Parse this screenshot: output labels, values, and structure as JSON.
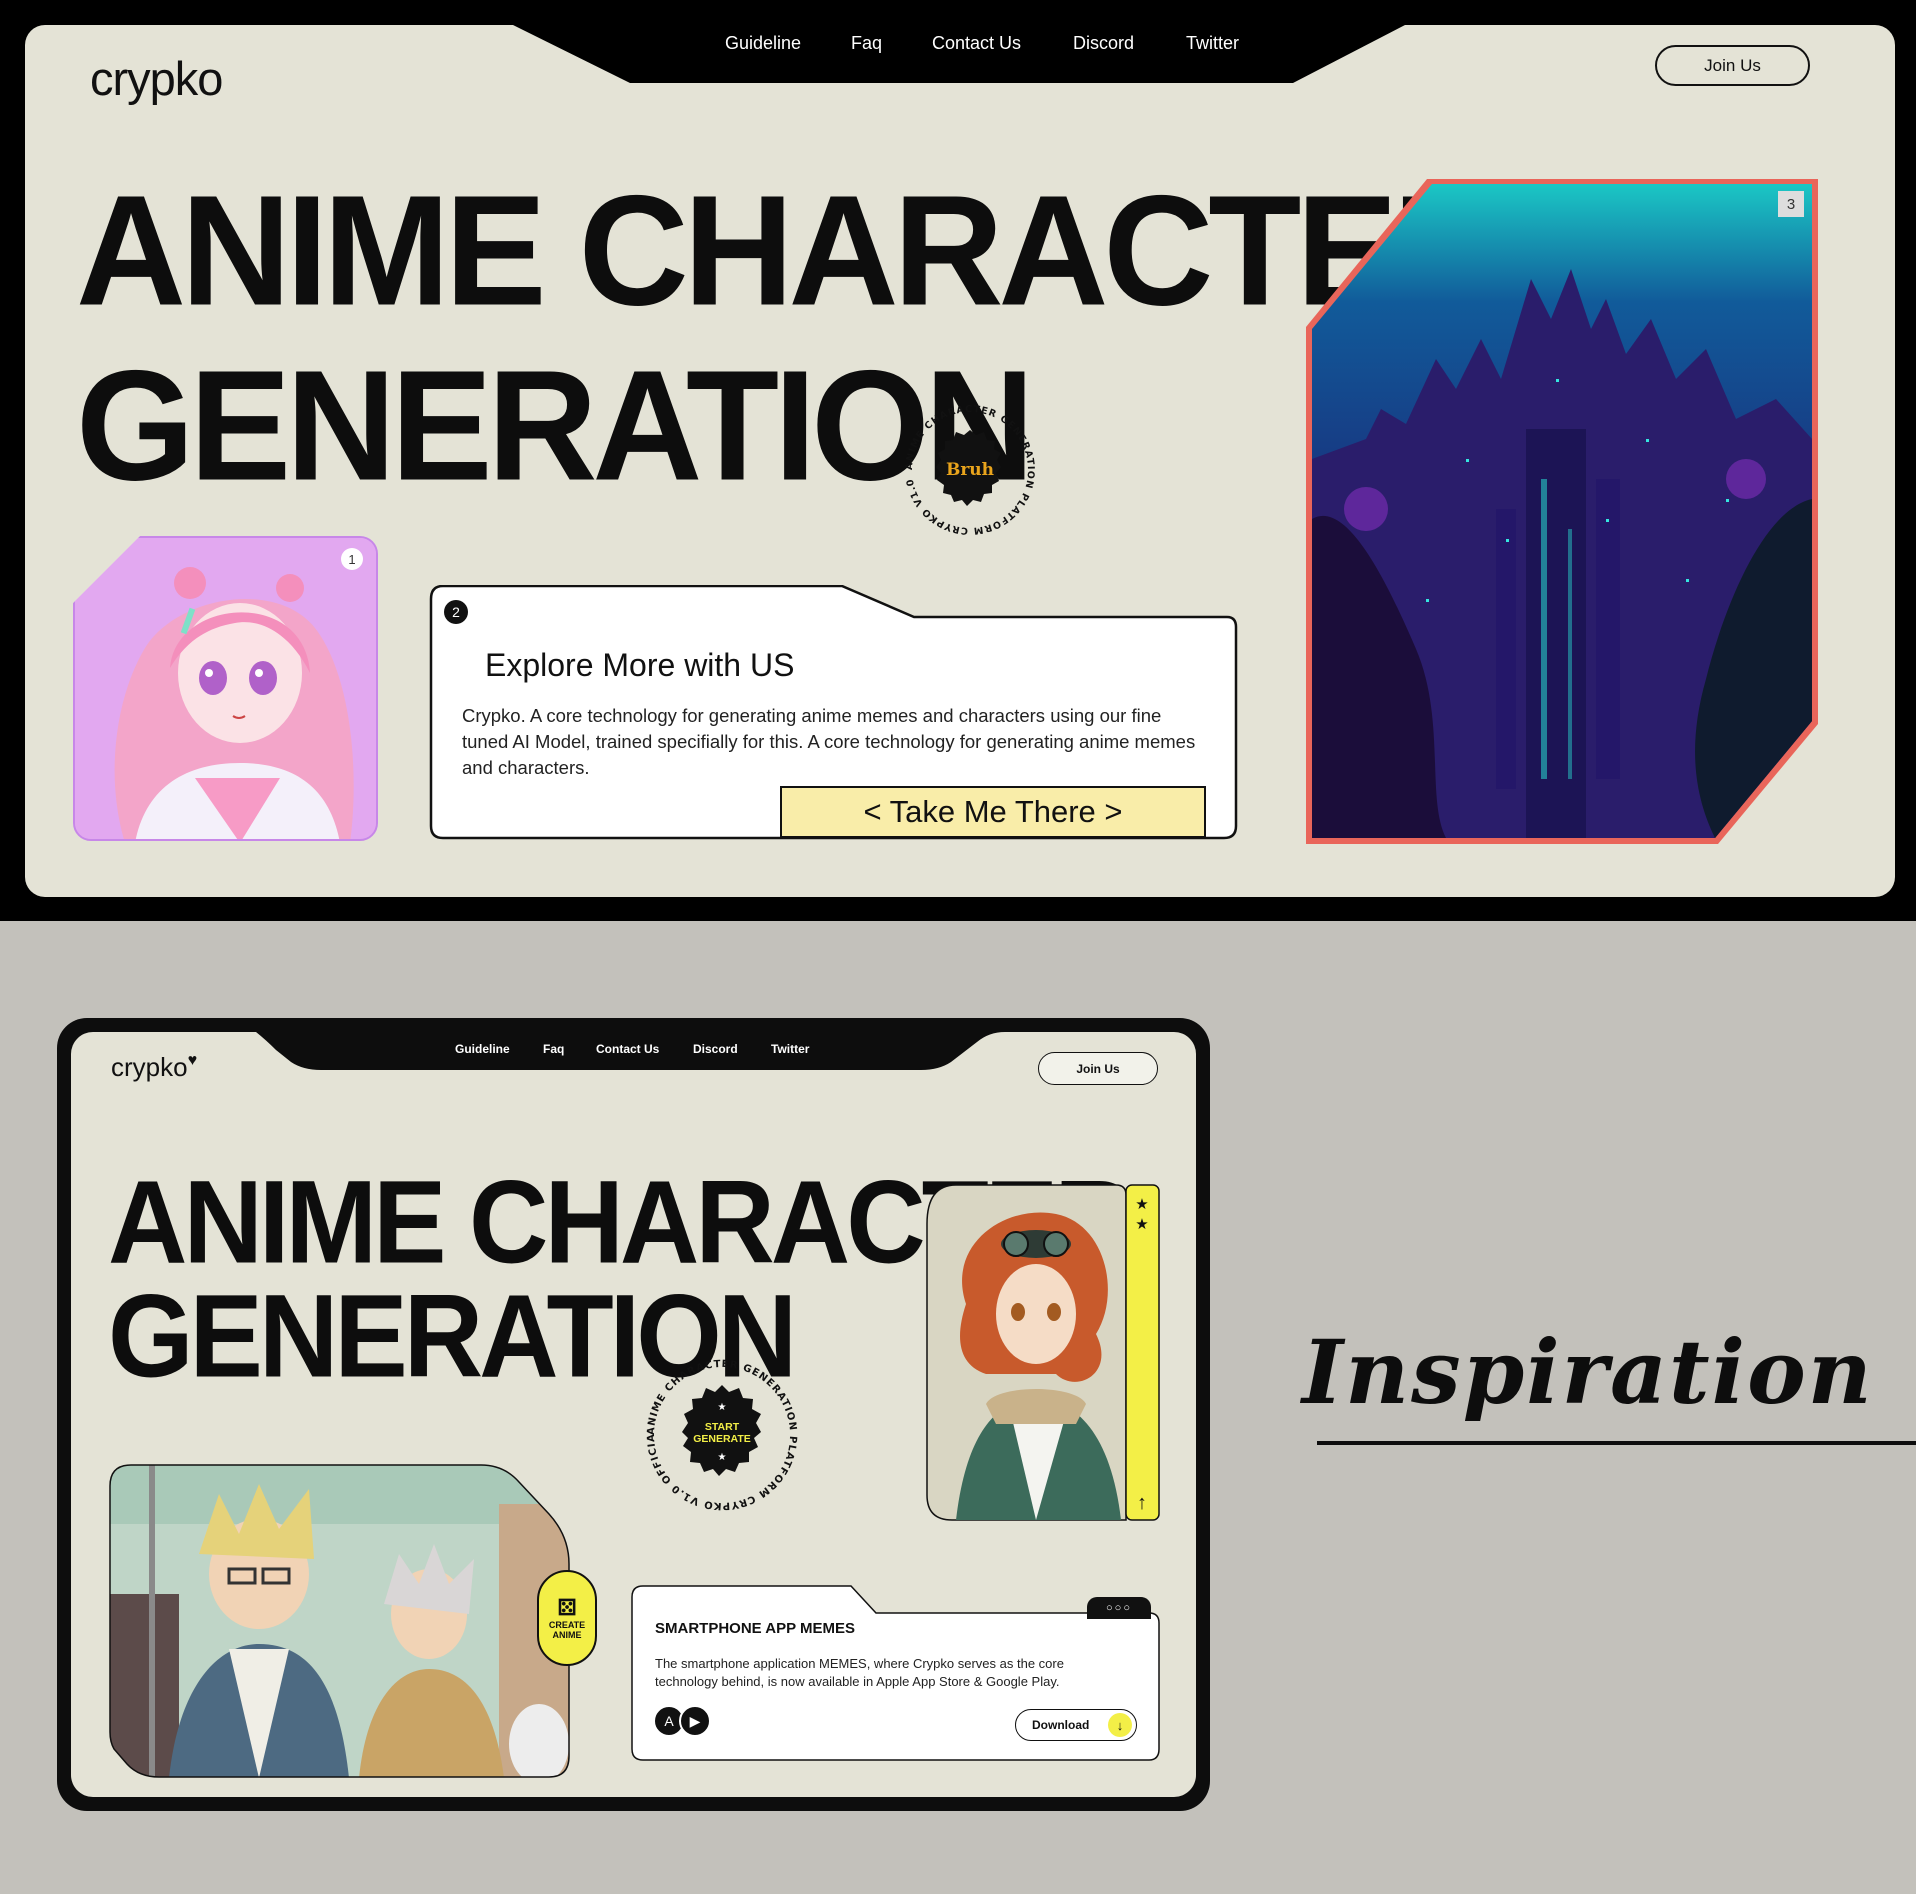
{
  "top_mockup": {
    "logo": "crypko",
    "nav": [
      "Guideline",
      "Faq",
      "Contact Us",
      "Discord",
      "Twitter"
    ],
    "join_label": "Join Us",
    "hero_line1": "ANIME CHARACTER",
    "hero_line2": "GENERATION",
    "seal": {
      "ring_text": "ANIME CHARACTER GENERATION PLATFORM CRYPKO V1.0 OFFICIAL RELEASE",
      "center_text": "Bruh"
    },
    "card1_number": "1",
    "explore": {
      "number": "2",
      "title": "Explore More with US",
      "body": "Crypko. A core technology for generating anime memes and characters using our fine tuned AI Model, trained specifially for this. A core technology for generating anime memes and characters.",
      "button_label": "< Take Me There >"
    },
    "city_number": "3",
    "colors": {
      "background": "#e4e3d6",
      "frame": "#000000",
      "button": "#f9eda9",
      "city_border": "#e9655a"
    }
  },
  "bottom_mockup": {
    "logo": "crypko",
    "nav": [
      "Guideline",
      "Faq",
      "Contact Us",
      "Discord",
      "Twitter"
    ],
    "join_label": "Join Us",
    "hero_line1": "ANIME CHARACTER",
    "hero_line2": "GENERATION",
    "seal": {
      "ring_text": "ANIME CHARACTER GENERATION PLATFORM CRYPKO V1.0 OFFICIAL RELEASE",
      "center_line1": "START",
      "center_line2": "GENERATE"
    },
    "create_pill": {
      "line1": "CREATE",
      "line2": "ANIME"
    },
    "app_card": {
      "title": "SMARTPHONE APP MEMES",
      "body": "The smartphone application MEMES, where Crypko serves as the core technology behind, is now available in Apple App Store & Google Play.",
      "download_label": "Download"
    },
    "colors": {
      "accent_yellow": "#f3ef47"
    }
  },
  "inspiration_label": "Inspiration",
  "icons": [
    "heart-icon",
    "dice-icon",
    "star-icon",
    "arrow-up-icon",
    "app-store-icon",
    "play-store-icon",
    "download-icon",
    "more-dots-icon"
  ]
}
